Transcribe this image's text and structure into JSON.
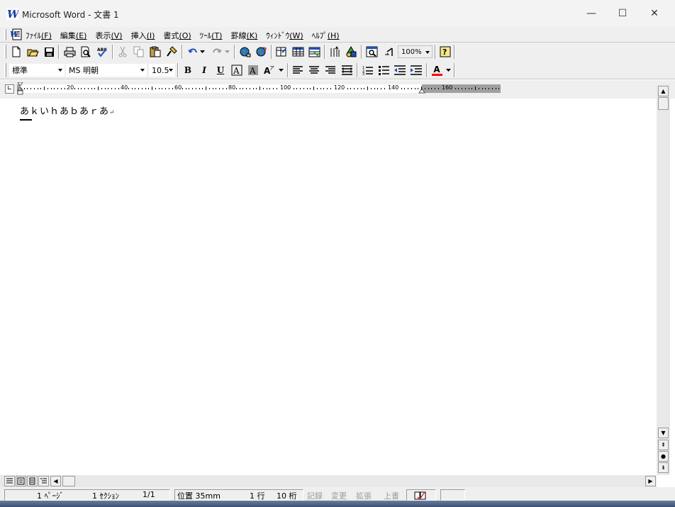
{
  "window": {
    "title": "Microsoft Word - 文書 1",
    "minimize_glyph": "—",
    "maximize_glyph": "☐",
    "close_glyph": "✕"
  },
  "menu": {
    "items": [
      {
        "label": "ﾌｧｲﾙ",
        "key": "(F)"
      },
      {
        "label": "編集",
        "key": "(E)"
      },
      {
        "label": "表示",
        "key": "(V)"
      },
      {
        "label": "挿入",
        "key": "(I)"
      },
      {
        "label": "書式",
        "key": "(O)"
      },
      {
        "label": "ﾂｰﾙ",
        "key": "(T)"
      },
      {
        "label": "罫線",
        "key": "(K)"
      },
      {
        "label": "ｳｨﾝﾄﾞｳ",
        "key": "(W)"
      },
      {
        "label": "ﾍﾙﾌﾟ",
        "key": "(H)"
      }
    ]
  },
  "toolbar": {
    "zoom": "100%"
  },
  "formatting": {
    "style": "標準",
    "font": "MS 明朝",
    "size": "10.5",
    "bold": "B",
    "italic": "I",
    "underline": "U",
    "font_color_letter": "A"
  },
  "ruler": {
    "labels": [
      "20",
      "40",
      "60",
      "80",
      "100",
      "120",
      "140",
      "160"
    ]
  },
  "document": {
    "text": "あｋいｈあｂあｒあ",
    "para_mark": "↵"
  },
  "status": {
    "page": "1 ﾍﾟｰｼﾞ",
    "section": "1 ｾｸｼｮﾝ",
    "pages": "1/1",
    "position": "位置  35mm",
    "line": "1 行",
    "column": "10 桁",
    "rec": "記録",
    "trk": "変更",
    "ext": "拡張",
    "ovr": "上書"
  },
  "colors": {
    "font_color_bar": "#ff0000",
    "accent_icon": "#1f4fbf"
  }
}
